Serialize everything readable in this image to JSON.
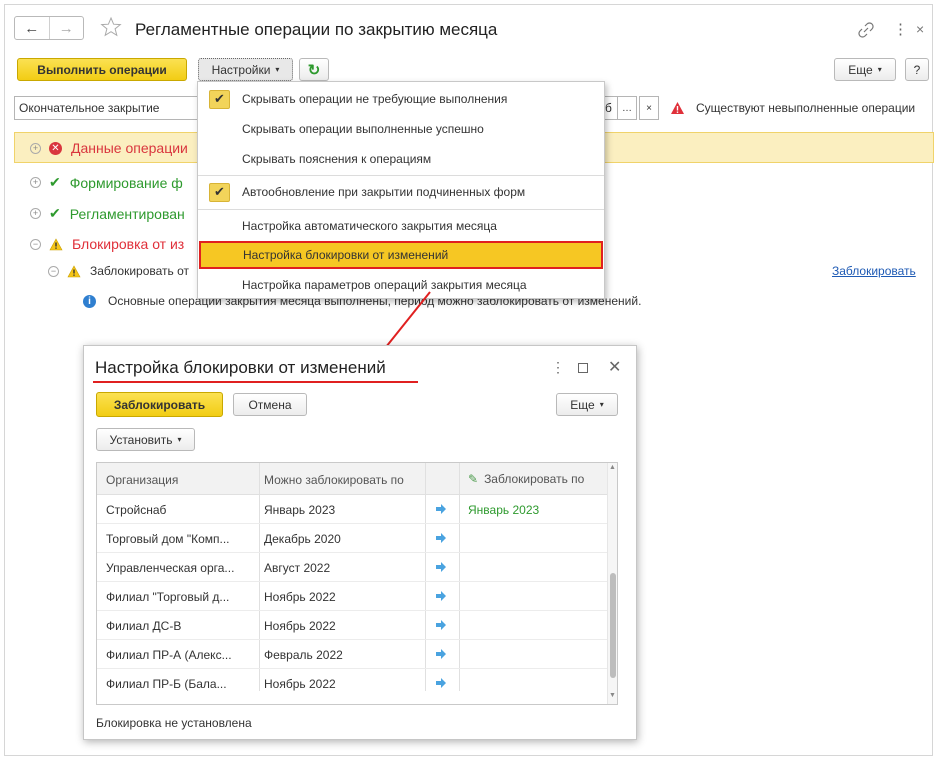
{
  "window": {
    "title": "Регламентные операции по закрытию месяца",
    "more_icon": "⋮",
    "close_icon": "×"
  },
  "toolbar": {
    "run_label": "Выполнить операции",
    "settings_label": "Настройки",
    "more_label": "Еще",
    "help_label": "?"
  },
  "filter": {
    "mode_value": "Окончательное закрытие",
    "org_partial": "б",
    "warning_text": "Существуют невыполненные операции"
  },
  "tree": {
    "rows": [
      {
        "label": "Данные операции",
        "status": "error"
      },
      {
        "label": "Формирование ф",
        "status": "ok"
      },
      {
        "label": "Регламентирован",
        "status": "ok"
      },
      {
        "label": "Блокировка от из",
        "status": "warning"
      }
    ],
    "child_label": "Заблокировать от",
    "child_link": "Заблокировать",
    "info_text": "Основные операции закрытия месяца выполнены, период можно заблокировать от изменений."
  },
  "menu": {
    "items": [
      {
        "label": "Скрывать операции не требующие выполнения",
        "checked": true
      },
      {
        "label": "Скрывать операции выполненные успешно",
        "checked": false
      },
      {
        "label": "Скрывать пояснения к операциям",
        "checked": false
      },
      {
        "label": "Автообновление при закрытии подчиненных форм",
        "checked": true
      },
      {
        "label": "Настройка автоматического закрытия месяца",
        "checked": false
      },
      {
        "label": "Настройка блокировки от изменений",
        "checked": false,
        "highlighted": true
      },
      {
        "label": "Настройка параметров операций закрытия месяца",
        "checked": false
      }
    ]
  },
  "dialog": {
    "title": "Настройка блокировки от изменений",
    "lock_label": "Заблокировать",
    "cancel_label": "Отмена",
    "more_label": "Еще",
    "set_label": "Установить",
    "columns": [
      "Организация",
      "Можно заблокировать по",
      "Заблокировать по"
    ],
    "rows": [
      {
        "org": "Стройснаб",
        "can_lock": "Январь 2023",
        "lock_to": "Январь 2023"
      },
      {
        "org": "Торговый дом \"Комп...",
        "can_lock": "Декабрь 2020",
        "lock_to": ""
      },
      {
        "org": "Управленческая орга...",
        "can_lock": "Август 2022",
        "lock_to": ""
      },
      {
        "org": "Филиал \"Торговый д...",
        "can_lock": "Ноябрь 2022",
        "lock_to": ""
      },
      {
        "org": "Филиал ДС-В",
        "can_lock": "Ноябрь 2022",
        "lock_to": ""
      },
      {
        "org": "Филиал ПР-А (Алекс...",
        "can_lock": "Февраль 2022",
        "lock_to": ""
      },
      {
        "org": "Филиал ПР-Б (Бала...",
        "can_lock": "Ноябрь 2022",
        "lock_to": ""
      }
    ],
    "status": "Блокировка не установлена"
  },
  "colors": {
    "accent_yellow": "#f2cd14",
    "highlight_red": "#e02020",
    "ok_green": "#2e9a2e",
    "error_red": "#d9363e",
    "warn_red_text": "#e0303a",
    "link_blue": "#1e5ab4",
    "arrow_blue": "#4aa3e0"
  }
}
